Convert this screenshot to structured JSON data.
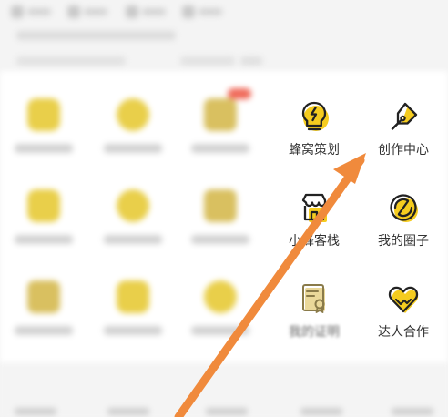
{
  "colors": {
    "accent_yellow": "#F5CC1F",
    "icon_stroke": "#222222",
    "label_text": "#333333",
    "arrow": "#F08A3C",
    "badge_red": "#F06A5A"
  },
  "visible_services": [
    {
      "id": "fengwo-planning",
      "label": "蜂窝策划",
      "icon": "lightning-bulb-icon"
    },
    {
      "id": "creation-center",
      "label": "创作中心",
      "icon": "pen-nib-icon"
    },
    {
      "id": "small-inn",
      "label": "小蜂客栈",
      "icon": "shop-awning-icon"
    },
    {
      "id": "my-circle",
      "label": "我的圈子",
      "icon": "circle-slash-icon"
    },
    {
      "id": "certificate",
      "label": "我的证明",
      "icon": "certificate-icon"
    },
    {
      "id": "expert-cooperation",
      "label": "达人合作",
      "icon": "handshake-heart-icon"
    }
  ],
  "overlay": {
    "annotation": "orange-arrow-pointing-to-creation-center"
  }
}
